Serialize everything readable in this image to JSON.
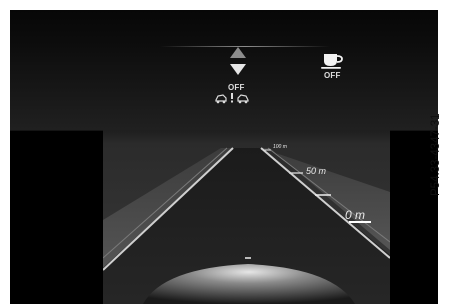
{
  "status": {
    "assist_off_label": "OFF",
    "attention_assist_off_label": "OFF"
  },
  "distance_markers": {
    "far": "100 m",
    "mid": "50 m",
    "near": "0 m"
  },
  "figure_id": "P54.33-4347-31",
  "icons": {
    "up": "triangle-up-icon",
    "down": "triangle-down-icon",
    "cars": "car-distance-icon",
    "coffee": "coffee-cup-icon"
  },
  "colors": {
    "display_bg": "#000000",
    "text": "#eaeaea"
  }
}
